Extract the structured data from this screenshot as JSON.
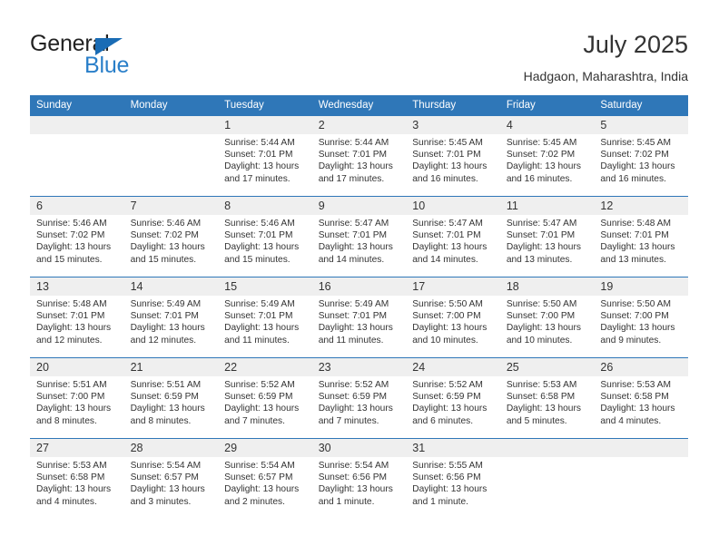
{
  "brand": {
    "name_part1": "General",
    "name_part2": "Blue",
    "accent_color": "#2a7fc9",
    "triangle_color": "#1a6cb5"
  },
  "header": {
    "title": "July 2025",
    "subtitle": "Hadgaon, Maharashtra, India"
  },
  "calendar": {
    "header_bg": "#2f77b8",
    "daynum_bg": "#efefef",
    "weekdays": [
      "Sunday",
      "Monday",
      "Tuesday",
      "Wednesday",
      "Thursday",
      "Friday",
      "Saturday"
    ],
    "weeks": [
      [
        {
          "day": "",
          "empty": true
        },
        {
          "day": "",
          "empty": true
        },
        {
          "day": "1",
          "sunrise": "Sunrise: 5:44 AM",
          "sunset": "Sunset: 7:01 PM",
          "daylight_1": "Daylight: 13 hours",
          "daylight_2": "and 17 minutes."
        },
        {
          "day": "2",
          "sunrise": "Sunrise: 5:44 AM",
          "sunset": "Sunset: 7:01 PM",
          "daylight_1": "Daylight: 13 hours",
          "daylight_2": "and 17 minutes."
        },
        {
          "day": "3",
          "sunrise": "Sunrise: 5:45 AM",
          "sunset": "Sunset: 7:01 PM",
          "daylight_1": "Daylight: 13 hours",
          "daylight_2": "and 16 minutes."
        },
        {
          "day": "4",
          "sunrise": "Sunrise: 5:45 AM",
          "sunset": "Sunset: 7:02 PM",
          "daylight_1": "Daylight: 13 hours",
          "daylight_2": "and 16 minutes."
        },
        {
          "day": "5",
          "sunrise": "Sunrise: 5:45 AM",
          "sunset": "Sunset: 7:02 PM",
          "daylight_1": "Daylight: 13 hours",
          "daylight_2": "and 16 minutes."
        }
      ],
      [
        {
          "day": "6",
          "sunrise": "Sunrise: 5:46 AM",
          "sunset": "Sunset: 7:02 PM",
          "daylight_1": "Daylight: 13 hours",
          "daylight_2": "and 15 minutes."
        },
        {
          "day": "7",
          "sunrise": "Sunrise: 5:46 AM",
          "sunset": "Sunset: 7:02 PM",
          "daylight_1": "Daylight: 13 hours",
          "daylight_2": "and 15 minutes."
        },
        {
          "day": "8",
          "sunrise": "Sunrise: 5:46 AM",
          "sunset": "Sunset: 7:01 PM",
          "daylight_1": "Daylight: 13 hours",
          "daylight_2": "and 15 minutes."
        },
        {
          "day": "9",
          "sunrise": "Sunrise: 5:47 AM",
          "sunset": "Sunset: 7:01 PM",
          "daylight_1": "Daylight: 13 hours",
          "daylight_2": "and 14 minutes."
        },
        {
          "day": "10",
          "sunrise": "Sunrise: 5:47 AM",
          "sunset": "Sunset: 7:01 PM",
          "daylight_1": "Daylight: 13 hours",
          "daylight_2": "and 14 minutes."
        },
        {
          "day": "11",
          "sunrise": "Sunrise: 5:47 AM",
          "sunset": "Sunset: 7:01 PM",
          "daylight_1": "Daylight: 13 hours",
          "daylight_2": "and 13 minutes."
        },
        {
          "day": "12",
          "sunrise": "Sunrise: 5:48 AM",
          "sunset": "Sunset: 7:01 PM",
          "daylight_1": "Daylight: 13 hours",
          "daylight_2": "and 13 minutes."
        }
      ],
      [
        {
          "day": "13",
          "sunrise": "Sunrise: 5:48 AM",
          "sunset": "Sunset: 7:01 PM",
          "daylight_1": "Daylight: 13 hours",
          "daylight_2": "and 12 minutes."
        },
        {
          "day": "14",
          "sunrise": "Sunrise: 5:49 AM",
          "sunset": "Sunset: 7:01 PM",
          "daylight_1": "Daylight: 13 hours",
          "daylight_2": "and 12 minutes."
        },
        {
          "day": "15",
          "sunrise": "Sunrise: 5:49 AM",
          "sunset": "Sunset: 7:01 PM",
          "daylight_1": "Daylight: 13 hours",
          "daylight_2": "and 11 minutes."
        },
        {
          "day": "16",
          "sunrise": "Sunrise: 5:49 AM",
          "sunset": "Sunset: 7:01 PM",
          "daylight_1": "Daylight: 13 hours",
          "daylight_2": "and 11 minutes."
        },
        {
          "day": "17",
          "sunrise": "Sunrise: 5:50 AM",
          "sunset": "Sunset: 7:00 PM",
          "daylight_1": "Daylight: 13 hours",
          "daylight_2": "and 10 minutes."
        },
        {
          "day": "18",
          "sunrise": "Sunrise: 5:50 AM",
          "sunset": "Sunset: 7:00 PM",
          "daylight_1": "Daylight: 13 hours",
          "daylight_2": "and 10 minutes."
        },
        {
          "day": "19",
          "sunrise": "Sunrise: 5:50 AM",
          "sunset": "Sunset: 7:00 PM",
          "daylight_1": "Daylight: 13 hours",
          "daylight_2": "and 9 minutes."
        }
      ],
      [
        {
          "day": "20",
          "sunrise": "Sunrise: 5:51 AM",
          "sunset": "Sunset: 7:00 PM",
          "daylight_1": "Daylight: 13 hours",
          "daylight_2": "and 8 minutes."
        },
        {
          "day": "21",
          "sunrise": "Sunrise: 5:51 AM",
          "sunset": "Sunset: 6:59 PM",
          "daylight_1": "Daylight: 13 hours",
          "daylight_2": "and 8 minutes."
        },
        {
          "day": "22",
          "sunrise": "Sunrise: 5:52 AM",
          "sunset": "Sunset: 6:59 PM",
          "daylight_1": "Daylight: 13 hours",
          "daylight_2": "and 7 minutes."
        },
        {
          "day": "23",
          "sunrise": "Sunrise: 5:52 AM",
          "sunset": "Sunset: 6:59 PM",
          "daylight_1": "Daylight: 13 hours",
          "daylight_2": "and 7 minutes."
        },
        {
          "day": "24",
          "sunrise": "Sunrise: 5:52 AM",
          "sunset": "Sunset: 6:59 PM",
          "daylight_1": "Daylight: 13 hours",
          "daylight_2": "and 6 minutes."
        },
        {
          "day": "25",
          "sunrise": "Sunrise: 5:53 AM",
          "sunset": "Sunset: 6:58 PM",
          "daylight_1": "Daylight: 13 hours",
          "daylight_2": "and 5 minutes."
        },
        {
          "day": "26",
          "sunrise": "Sunrise: 5:53 AM",
          "sunset": "Sunset: 6:58 PM",
          "daylight_1": "Daylight: 13 hours",
          "daylight_2": "and 4 minutes."
        }
      ],
      [
        {
          "day": "27",
          "sunrise": "Sunrise: 5:53 AM",
          "sunset": "Sunset: 6:58 PM",
          "daylight_1": "Daylight: 13 hours",
          "daylight_2": "and 4 minutes."
        },
        {
          "day": "28",
          "sunrise": "Sunrise: 5:54 AM",
          "sunset": "Sunset: 6:57 PM",
          "daylight_1": "Daylight: 13 hours",
          "daylight_2": "and 3 minutes."
        },
        {
          "day": "29",
          "sunrise": "Sunrise: 5:54 AM",
          "sunset": "Sunset: 6:57 PM",
          "daylight_1": "Daylight: 13 hours",
          "daylight_2": "and 2 minutes."
        },
        {
          "day": "30",
          "sunrise": "Sunrise: 5:54 AM",
          "sunset": "Sunset: 6:56 PM",
          "daylight_1": "Daylight: 13 hours",
          "daylight_2": "and 1 minute."
        },
        {
          "day": "31",
          "sunrise": "Sunrise: 5:55 AM",
          "sunset": "Sunset: 6:56 PM",
          "daylight_1": "Daylight: 13 hours",
          "daylight_2": "and 1 minute."
        },
        {
          "day": "",
          "empty": true
        },
        {
          "day": "",
          "empty": true
        }
      ]
    ]
  }
}
